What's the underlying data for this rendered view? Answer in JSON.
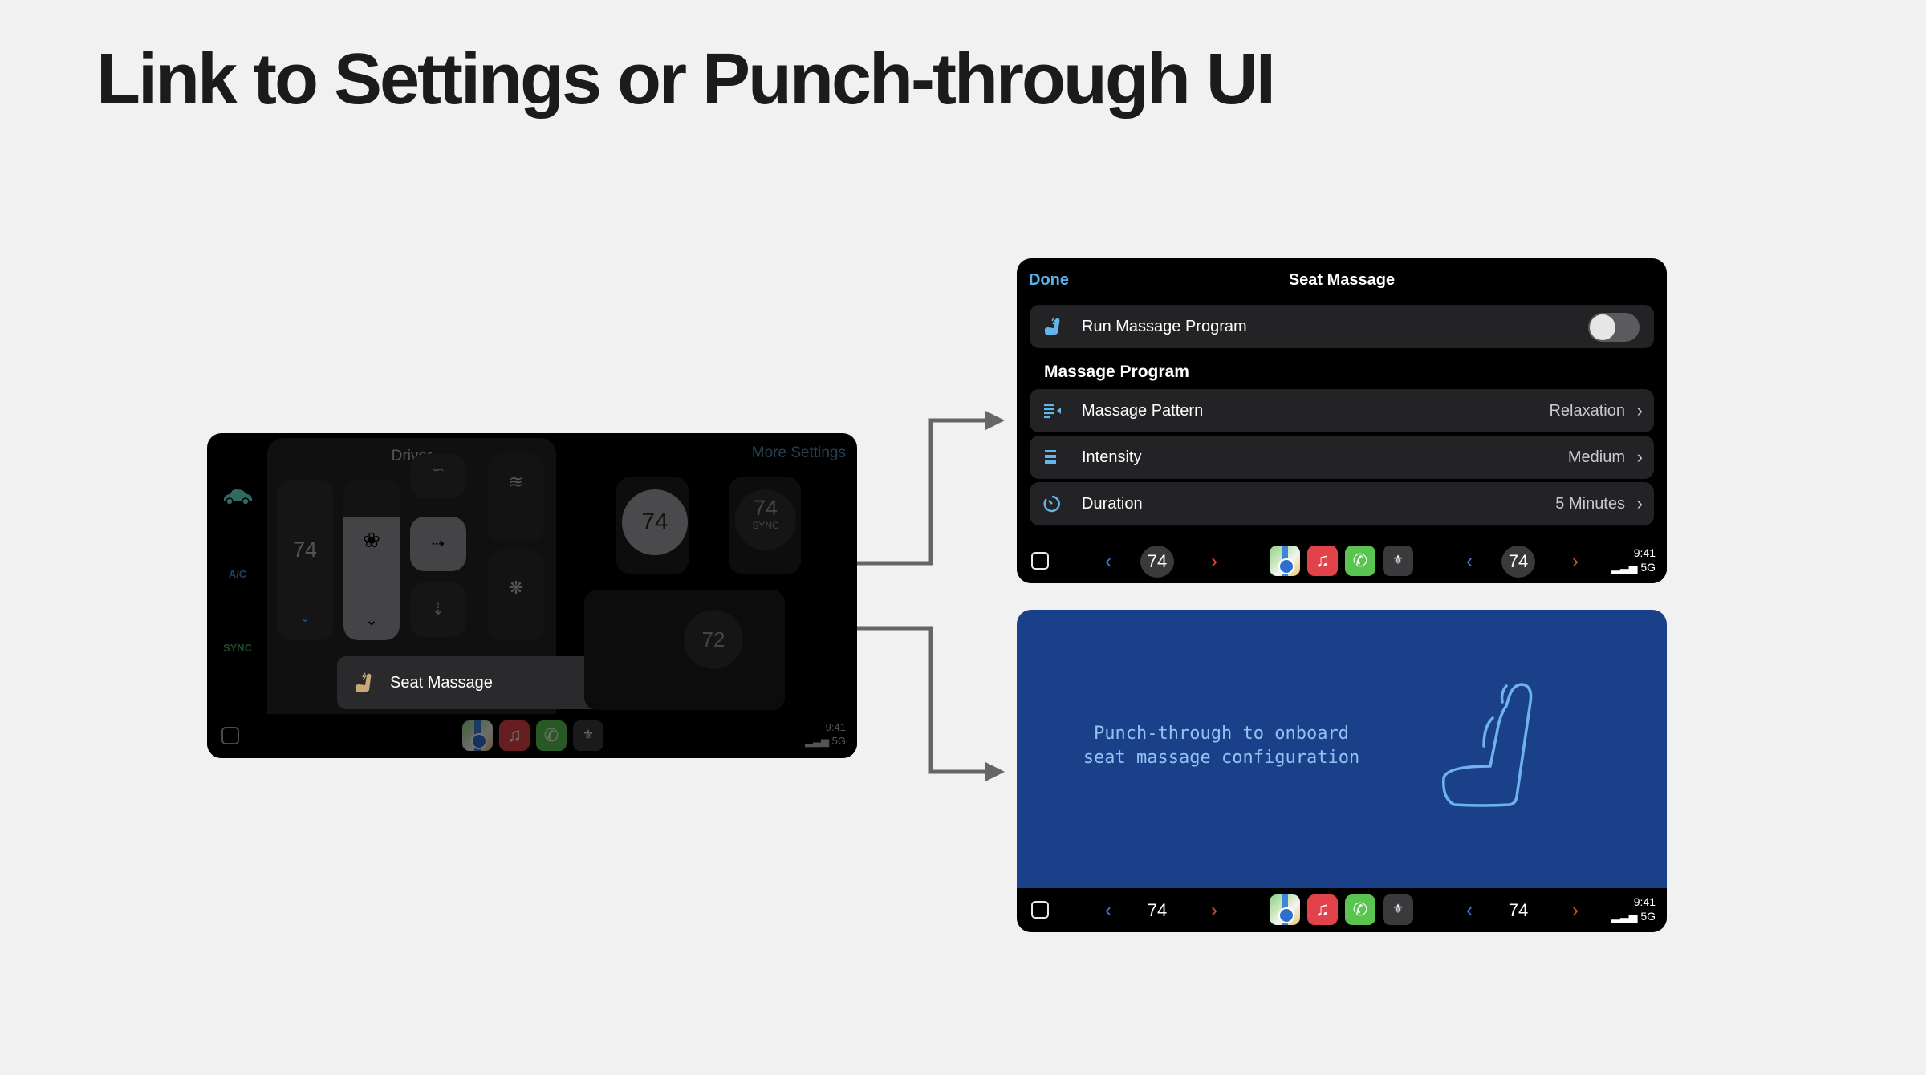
{
  "page": {
    "title": "Link to Settings or Punch-through UI"
  },
  "left_panel": {
    "sidebar": [
      {
        "icon": "car-icon",
        "label": ""
      },
      {
        "icon": "",
        "label": "A/C"
      },
      {
        "icon": "",
        "label": "SYNC"
      }
    ],
    "driver_label": "Driver",
    "driver_temp": "74",
    "more_settings": "More Settings",
    "seat_massage_label": "Seat Massage",
    "cabin": {
      "front_left_temp": "74",
      "front_right_temp": "74",
      "front_right_sub": "SYNC",
      "rear_temp": "72"
    },
    "status": {
      "time": "9:41",
      "network": "5G"
    }
  },
  "settings_panel": {
    "done_label": "Done",
    "title": "Seat Massage",
    "run_row": {
      "label": "Run Massage Program",
      "toggle_on": false
    },
    "section_header": "Massage Program",
    "rows": [
      {
        "icon": "pattern-icon",
        "label": "Massage Pattern",
        "value": "Relaxation"
      },
      {
        "icon": "intensity-icon",
        "label": "Intensity",
        "value": "Medium"
      },
      {
        "icon": "timer-icon",
        "label": "Duration",
        "value": "5 Minutes"
      }
    ]
  },
  "punch_panel": {
    "text_line1": "Punch-through to onboard",
    "text_line2": "seat massage configuration"
  },
  "dock": {
    "left_temp": "74",
    "right_temp": "74",
    "apps": [
      "Maps",
      "Music",
      "Phone",
      "Climate"
    ],
    "time": "9:41",
    "network": "5G"
  },
  "colors": {
    "accent_blue": "#5ab1ea",
    "punch_bg": "#1b408a",
    "punch_text": "#8fc4f2",
    "arrow": "#666666"
  }
}
